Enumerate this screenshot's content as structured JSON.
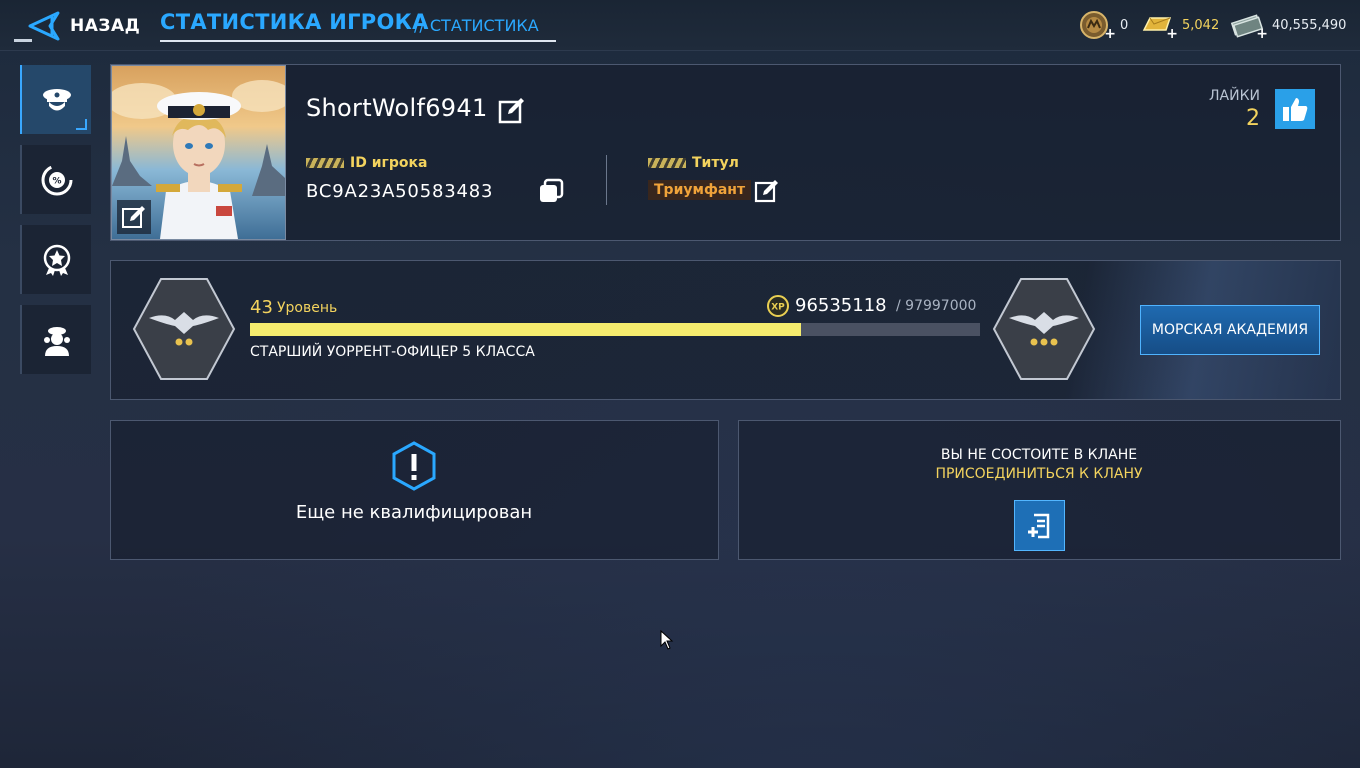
{
  "topbar": {
    "back_label": "НАЗАД",
    "title": "СТАТИСТИКА ИГРОКА",
    "subtitle": "// СТАТИСТИКА",
    "currencies": [
      {
        "name": "medal-currency",
        "value": "0",
        "color": "#e8edf3"
      },
      {
        "name": "gold-currency",
        "value": "5,042",
        "color": "#f3d35e"
      },
      {
        "name": "money-currency",
        "value": "40,555,490",
        "color": "#e8edf3"
      }
    ]
  },
  "sidebar": {
    "tabs": [
      {
        "icon": "captain-hat-icon",
        "active": true
      },
      {
        "icon": "percent-gauge-icon",
        "active": false
      },
      {
        "icon": "star-medal-icon",
        "active": false
      },
      {
        "icon": "crew-icon",
        "active": false
      }
    ]
  },
  "profile": {
    "name": "ShortWolf6941",
    "id_label": "ID игрока",
    "id_value": "BC9A23A50583483",
    "title_label": "Титул",
    "title_value": "Триумфант",
    "likes_label": "ЛАЙКИ",
    "likes_value": "2"
  },
  "level": {
    "number": "43",
    "word": "Уровень",
    "xp_current": "96535118",
    "xp_max": "/ 97997000",
    "progress": 0.755,
    "rank": "СТАРШИЙ УОРРЕНТ-ОФИЦЕР 5 КЛАССА",
    "academy_button": "МОРСКАЯ АКАДЕМИЯ"
  },
  "qualification": {
    "text": "Еще не квалифицирован"
  },
  "clan": {
    "status": "ВЫ НЕ СОСТОИТЕ В КЛАНЕ",
    "join": "ПРИСОЕДИНИТЬСЯ К КЛАНУ"
  },
  "colors": {
    "accent": "#2aa8ff",
    "gold": "#f3d35e",
    "bar_fill": "#f5ec6e"
  }
}
